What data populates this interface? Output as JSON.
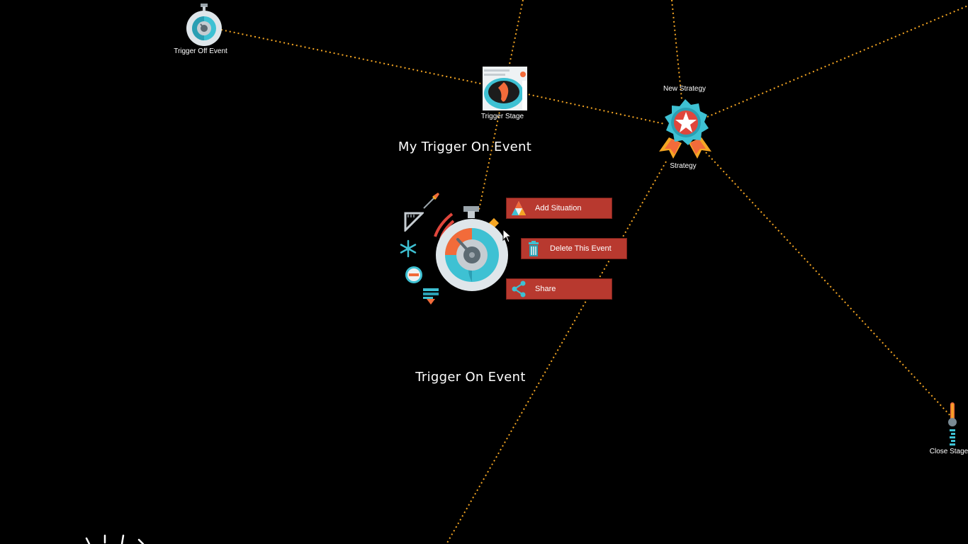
{
  "nodes": {
    "trigger_off_event": {
      "label": "Trigger Off Event"
    },
    "trigger_stage": {
      "label": "Trigger Stage"
    },
    "new_strategy": {
      "title": "New Strategy",
      "label": "Strategy"
    },
    "close_stage": {
      "label": "Close Stage"
    }
  },
  "selected_node": {
    "title": "My Trigger On Event",
    "label": "Trigger On Event"
  },
  "context_menu": {
    "add_situation": "Add Situation",
    "delete_event": "Delete This Event",
    "share": "Share"
  },
  "colors": {
    "background": "#000000",
    "link": "#f5a623",
    "button": "#b8392f",
    "accent_teal": "#3ec1d3",
    "accent_orange": "#f26b3a"
  },
  "tool_icons": [
    "pencil-icon",
    "ruler-icon",
    "snowflake-icon",
    "minus-circle-icon",
    "stack-download-icon",
    "arrow-pointer-icon"
  ]
}
